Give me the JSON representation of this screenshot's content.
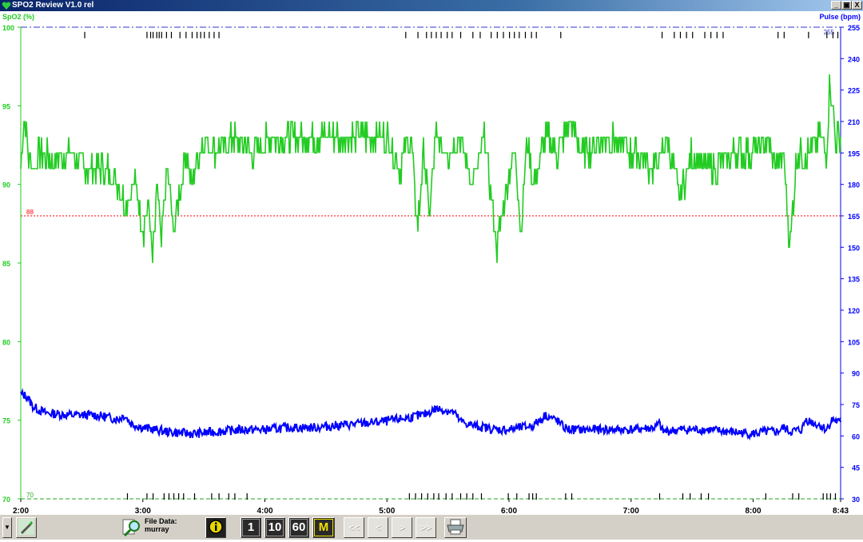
{
  "window": {
    "title": "SPO2 Review V1.0 rel",
    "controls": [
      "_",
      "\u0019",
      "X"
    ]
  },
  "chart_data": {
    "type": "line",
    "left_axis": {
      "label": "SpO2 (%)",
      "range": [
        70,
        100
      ],
      "ticks": [
        "70",
        "75",
        "80",
        "85",
        "90",
        "95",
        "100"
      ],
      "color": "#22cc22"
    },
    "right_axis": {
      "label": "Pulse (bpm)",
      "range": [
        30,
        255
      ],
      "ticks": [
        "30",
        "45",
        "60",
        "75",
        "90",
        "105",
        "120",
        "135",
        "150",
        "165",
        "180",
        "195",
        "210",
        "225",
        "240",
        "255"
      ],
      "color": "#0000ff"
    },
    "x_axis": {
      "ticks": [
        "2:00",
        "3:00",
        "4:00",
        "5:00",
        "6:00",
        "7:00",
        "8:00",
        "8:43"
      ],
      "tick_hours": [
        0,
        1,
        2,
        3,
        4,
        5,
        6,
        6.7167
      ],
      "range_hours": [
        0,
        6.7167
      ]
    },
    "reference_lines": [
      {
        "axis": "left",
        "value": 88,
        "label": "88",
        "color": "#ff0000",
        "style": "dotted"
      },
      {
        "axis": "left",
        "value": 70,
        "label": "70",
        "color": "#22aa22",
        "style": "dashed"
      },
      {
        "axis": "right",
        "value": 255,
        "label": "255",
        "color": "#3333cc",
        "style": "dashdot"
      }
    ],
    "series": [
      {
        "name": "SpO2",
        "axis": "left",
        "color": "#22cc22",
        "t": [
          0,
          0.03,
          0.06,
          0.1,
          0.15,
          0.25,
          0.4,
          0.55,
          0.7,
          0.8,
          0.85,
          0.95,
          1.0,
          1.05,
          1.08,
          1.12,
          1.15,
          1.2,
          1.25,
          1.35,
          1.4,
          1.5,
          1.6,
          1.75,
          1.9,
          2.05,
          2.15,
          2.3,
          2.5,
          2.8,
          3.0,
          3.1,
          3.2,
          3.25,
          3.3,
          3.35,
          3.4,
          3.5,
          3.6,
          3.7,
          3.8,
          3.9,
          4.0,
          4.05,
          4.1,
          4.15,
          4.2,
          4.3,
          4.4,
          4.5,
          4.6,
          4.8,
          5.0,
          5.2,
          5.3,
          5.4,
          5.5,
          5.6,
          5.7,
          5.85,
          6.0,
          6.1,
          6.2,
          6.25,
          6.3,
          6.33,
          6.36,
          6.45,
          6.55,
          6.6,
          6.63,
          6.67,
          6.7167
        ],
        "values": [
          91,
          94,
          92,
          91,
          92,
          91.5,
          92,
          91,
          91,
          90,
          89,
          90,
          87,
          89,
          85,
          90,
          86,
          91,
          87,
          92,
          90,
          93,
          92,
          93,
          92,
          93,
          93,
          93,
          93,
          93,
          93,
          91,
          93,
          87,
          92,
          88,
          93,
          92,
          93,
          90,
          93,
          86,
          91,
          92,
          87,
          93,
          90,
          93,
          92,
          94,
          92,
          93,
          92,
          91,
          93,
          89,
          92,
          91,
          91,
          92,
          92,
          93,
          91,
          92,
          86,
          89,
          92,
          92,
          93,
          92,
          97,
          93,
          93
        ]
      },
      {
        "name": "Pulse",
        "axis": "right",
        "color": "#0000ff",
        "t": [
          0,
          0.05,
          0.1,
          0.2,
          0.4,
          0.6,
          0.8,
          0.85,
          0.9,
          1.0,
          1.1,
          1.2,
          1.4,
          1.6,
          1.8,
          2.0,
          2.2,
          2.4,
          2.6,
          2.8,
          3.0,
          3.2,
          3.3,
          3.4,
          3.5,
          3.55,
          3.6,
          3.7,
          3.8,
          3.9,
          4.0,
          4.1,
          4.2,
          4.3,
          4.4,
          4.45,
          4.5,
          4.6,
          4.8,
          5.0,
          5.2,
          5.23,
          5.26,
          5.4,
          5.6,
          5.8,
          6.0,
          6.1,
          6.2,
          6.25,
          6.3,
          6.4,
          6.43,
          6.5,
          6.55,
          6.6,
          6.65,
          6.7167
        ],
        "values": [
          80,
          79,
          74,
          71,
          70,
          70,
          68,
          70,
          66,
          64,
          63,
          62,
          61,
          62,
          63,
          63,
          64,
          64,
          65,
          66,
          67,
          69,
          70,
          73,
          72,
          71,
          67,
          65,
          64,
          63,
          63,
          64,
          65,
          70,
          67,
          64,
          63,
          63,
          63,
          63,
          64,
          66,
          62,
          63,
          63,
          62,
          61,
          62,
          62,
          64,
          62,
          63,
          68,
          66,
          65,
          63,
          68,
          66
        ]
      }
    ],
    "event_rows": [
      {
        "axis_value": 99.5,
        "color": "#000000",
        "t": [
          0.52,
          1.03,
          1.06,
          1.08,
          1.11,
          1.13,
          1.15,
          1.19,
          1.23,
          1.3,
          1.35,
          1.4,
          1.44,
          1.47,
          1.5,
          1.54,
          1.58,
          1.62,
          3.15,
          3.25,
          3.32,
          3.36,
          3.4,
          3.44,
          3.49,
          3.53,
          3.6,
          3.7,
          3.76,
          3.85,
          3.9,
          3.95,
          4.0,
          4.04,
          4.08,
          4.13,
          4.18,
          4.22,
          4.42,
          5.25,
          5.35,
          5.4,
          5.45,
          5.5,
          5.6,
          5.65,
          5.7,
          5.75,
          6.2,
          6.25,
          6.45,
          6.6,
          6.65,
          6.69
        ]
      },
      {
        "axis_value": 70.15,
        "color": "#000000",
        "t": [
          0.87,
          1.03,
          1.08,
          1.17,
          1.21,
          1.25,
          1.29,
          1.33,
          1.42,
          1.56,
          1.62,
          1.7,
          1.75,
          1.85,
          3.18,
          3.23,
          3.28,
          3.33,
          3.38,
          3.42,
          3.48,
          3.53,
          3.6,
          3.65,
          3.7,
          3.77,
          3.99,
          4.06,
          4.16,
          4.19,
          4.22,
          4.46,
          4.51,
          5.23,
          5.42,
          5.48,
          5.57,
          5.63,
          6.1,
          6.32,
          6.37,
          6.57,
          6.6,
          6.63,
          6.67
        ]
      }
    ]
  },
  "toolbar": {
    "file_label": "File Data:",
    "file_name": "murray",
    "scale_buttons": [
      "1",
      "10",
      "60",
      "M"
    ],
    "nav_buttons": [
      "<<",
      "<",
      ">",
      ">>"
    ]
  }
}
